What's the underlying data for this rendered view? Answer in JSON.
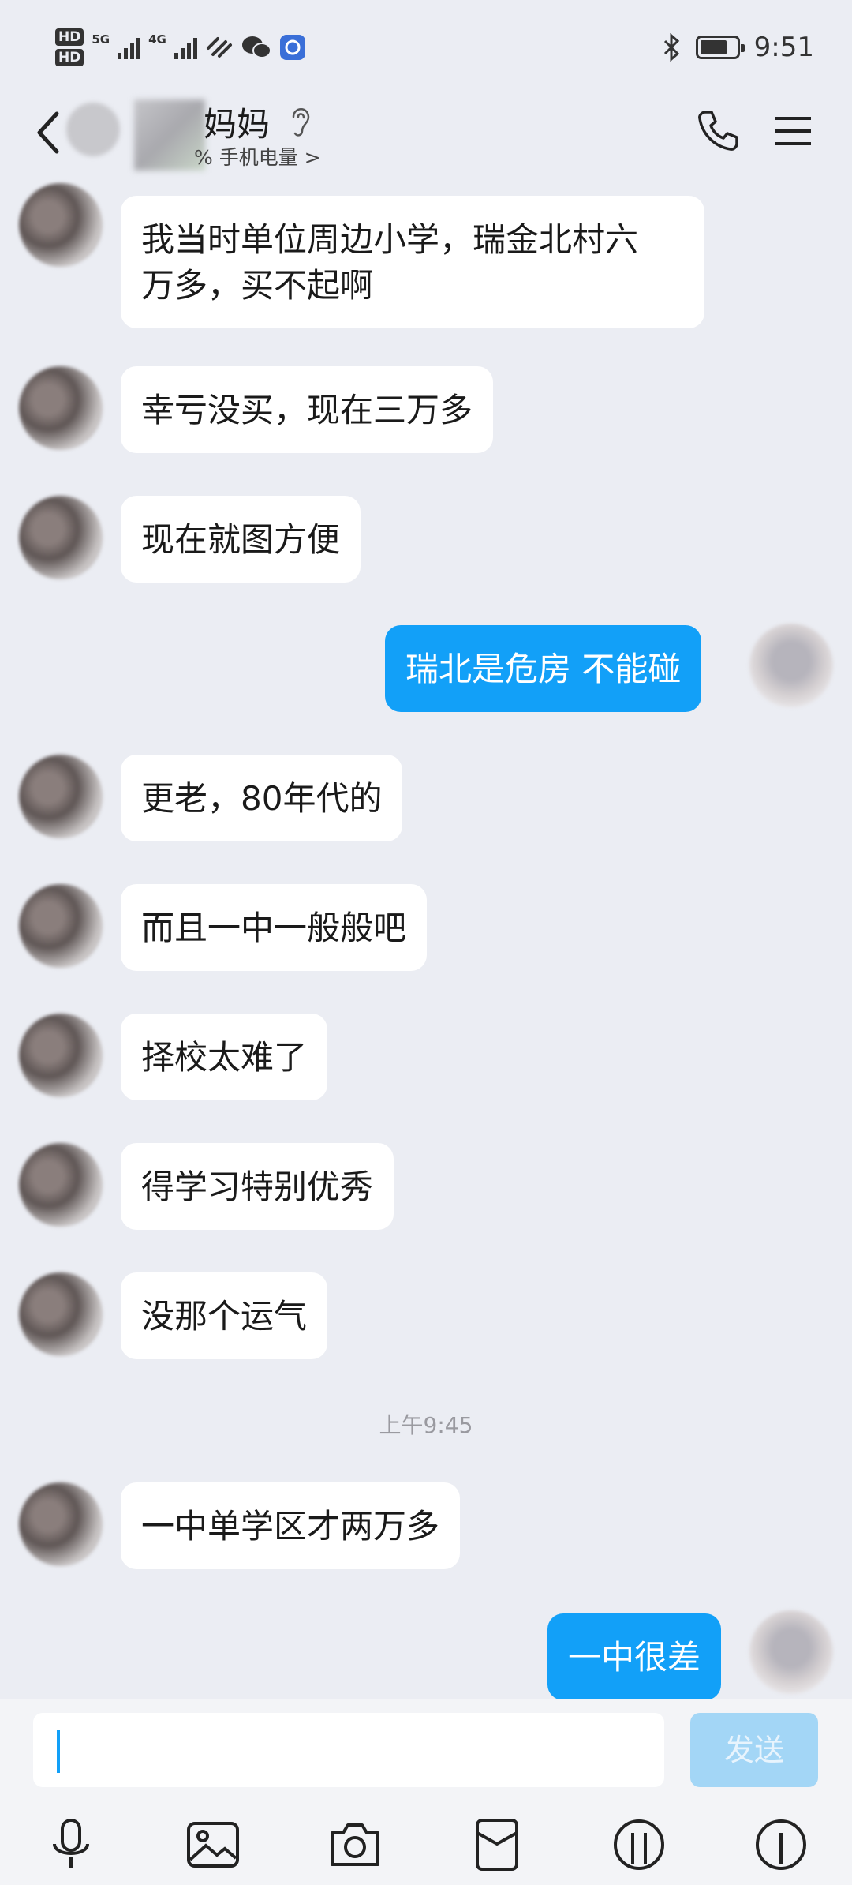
{
  "status_bar": {
    "time": "9:51",
    "hd_labels": [
      "HD",
      "HD"
    ],
    "network_1": "5G",
    "network_2": "4G",
    "battery_percent": 75
  },
  "header": {
    "contact_name": "妈妈",
    "subtitle": "% 手机电量 >"
  },
  "messages": [
    {
      "side": "left",
      "text": "我当时单位周边小学，瑞金北村六\n万多，买不起啊"
    },
    {
      "side": "left",
      "text": "幸亏没买，现在三万多"
    },
    {
      "side": "left",
      "text": "现在就图方便"
    },
    {
      "side": "right",
      "text": "瑞北是危房  不能碰"
    },
    {
      "side": "left",
      "text": "更老，80年代的"
    },
    {
      "side": "left",
      "text": "而且一中一般般吧"
    },
    {
      "side": "left",
      "text": "择校太难了"
    },
    {
      "side": "left",
      "text": "得学习特别优秀"
    },
    {
      "side": "left",
      "text": "没那个运气"
    },
    {
      "type": "time",
      "text": "上午9:45"
    },
    {
      "side": "left",
      "text": "一中单学区才两万多"
    },
    {
      "side": "right",
      "text": "一中很差"
    }
  ],
  "input": {
    "value": "",
    "send_label": "发送"
  },
  "colors": {
    "background": "#ebedf3",
    "outgoing_bubble": "#12a0f8",
    "incoming_bubble": "#ffffff",
    "send_button": "#a3d6f6"
  },
  "icons": {
    "back": "chevron-left-icon",
    "ear": "ear-icon",
    "phone": "phone-icon",
    "menu": "menu-icon",
    "tools": [
      "microphone-icon",
      "image-icon",
      "camera-icon",
      "red-packet-icon",
      "emoji-icon",
      "emoji-icon"
    ]
  }
}
